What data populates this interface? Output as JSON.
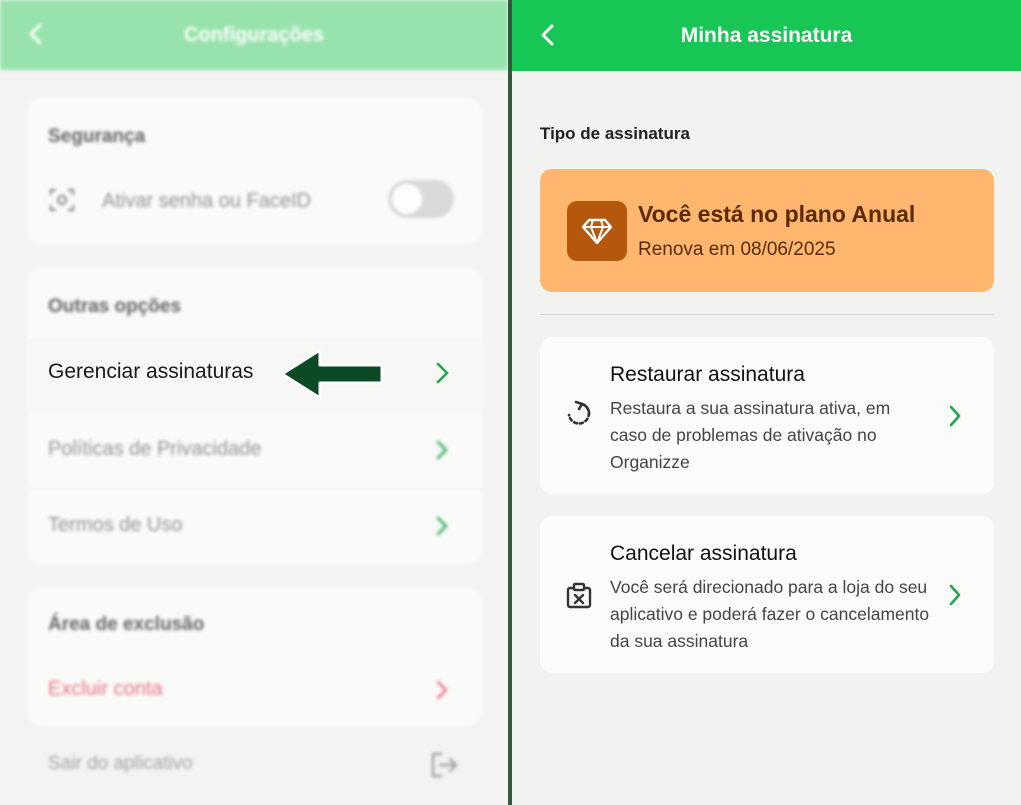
{
  "left": {
    "header_title": "Configurações",
    "seguranca": {
      "title": "Segurança",
      "item_label": "Ativar senha ou FaceID"
    },
    "outras": {
      "title": "Outras opções",
      "items": [
        {
          "label": "Gerenciar assinaturas"
        },
        {
          "label": "Políticas de Privacidade"
        },
        {
          "label": "Termos de Uso"
        }
      ]
    },
    "exclusao": {
      "title": "Área de exclusão",
      "item_label": "Excluir conta"
    },
    "sair_label": "Sair do aplicativo"
  },
  "right": {
    "header_title": "Minha assinatura",
    "tipo_label": "Tipo de assinatura",
    "plan": {
      "title": "Você está no plano Anual",
      "renew": "Renova em 08/06/2025"
    },
    "restore": {
      "title": "Restaurar assinatura",
      "description": "Restaura a sua assinatura ativa, em caso de problemas de ativação no Organizze"
    },
    "cancel": {
      "title": "Cancelar assinatura",
      "description": "Você será direcionado para a loja do seu aplicativo e poderá fazer o cancelamento da sua assinatura"
    }
  },
  "colors": {
    "left_header": "#8fe2a6",
    "right_header": "#17c654",
    "plan_card": "#ffb66e",
    "plan_badge": "#b5580d",
    "chevron": "#1fa84c",
    "danger": "#e8667a",
    "arrow": "#0b4a25"
  },
  "icons": {
    "back": "chevron-left-icon",
    "faceid": "face-id-icon",
    "chevron": "chevron-right-icon",
    "logout": "logout-icon",
    "plan": "diamond-icon",
    "restore": "restore-icon",
    "cancel": "clipboard-x-icon",
    "pointer": "arrow-left-icon"
  }
}
